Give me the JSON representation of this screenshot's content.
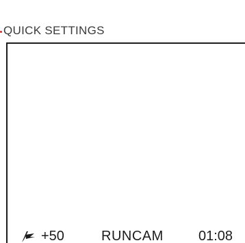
{
  "header": {
    "title": "QUICK SETTINGS",
    "accent_color": "#cf2a2a"
  },
  "status": {
    "flag_icon": "flag-icon",
    "offset": "+50",
    "camera_name": "RUNCAM",
    "time": "01:08"
  }
}
